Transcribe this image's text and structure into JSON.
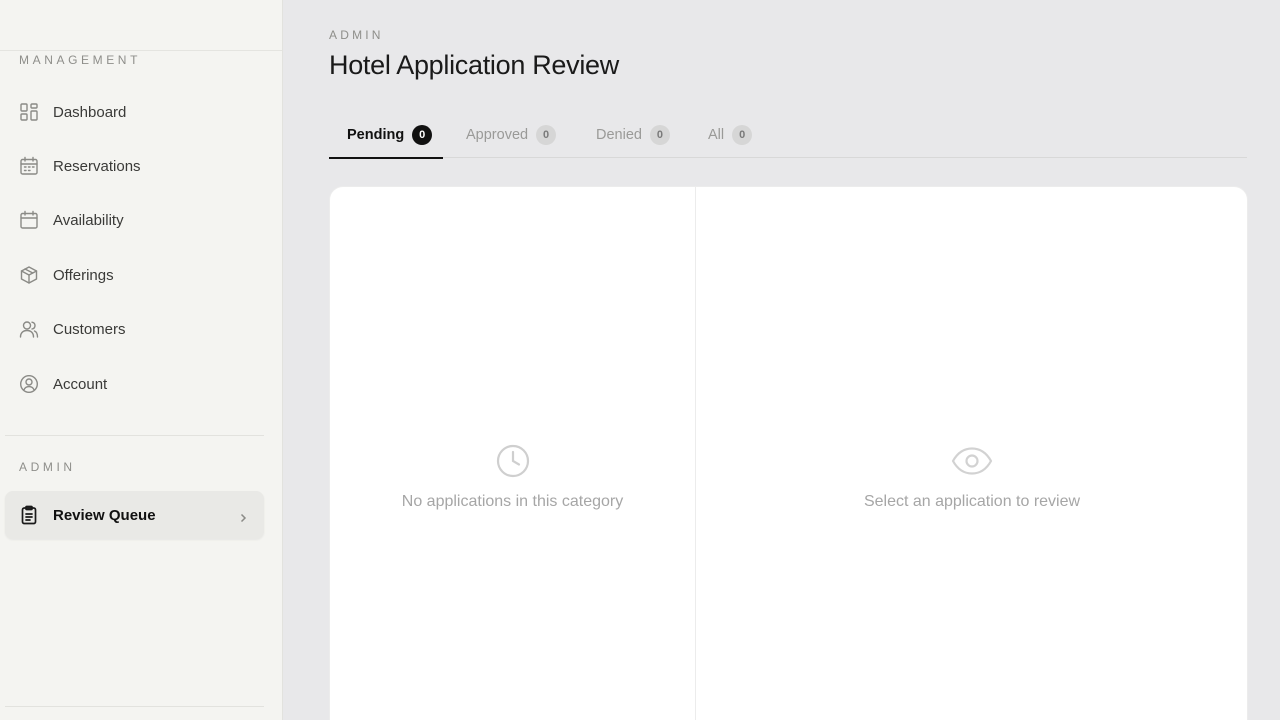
{
  "sidebar": {
    "management_label": "MANAGEMENT",
    "admin_label": "ADMIN",
    "items": [
      {
        "label": "Dashboard",
        "icon": "dashboard-grid-icon"
      },
      {
        "label": "Reservations",
        "icon": "calendar-list-icon"
      },
      {
        "label": "Availability",
        "icon": "calendar-icon"
      },
      {
        "label": "Offerings",
        "icon": "box-icon"
      },
      {
        "label": "Customers",
        "icon": "users-icon"
      },
      {
        "label": "Account",
        "icon": "user-circle-icon"
      }
    ],
    "admin_items": [
      {
        "label": "Review Queue",
        "icon": "clipboard-icon",
        "active": true
      }
    ]
  },
  "main": {
    "eyebrow": "ADMIN",
    "title": "Hotel Application Review",
    "tabs": [
      {
        "label": "Pending",
        "count": "0",
        "active": true
      },
      {
        "label": "Approved",
        "count": "0"
      },
      {
        "label": "Denied",
        "count": "0"
      },
      {
        "label": "All",
        "count": "0"
      }
    ],
    "list_empty_message": "No applications in this category",
    "detail_empty_message": "Select an application to review"
  },
  "colors": {
    "accent": "#111111",
    "sidebar_bg": "#f4f4f1",
    "page_bg": "#e8e8ea"
  }
}
